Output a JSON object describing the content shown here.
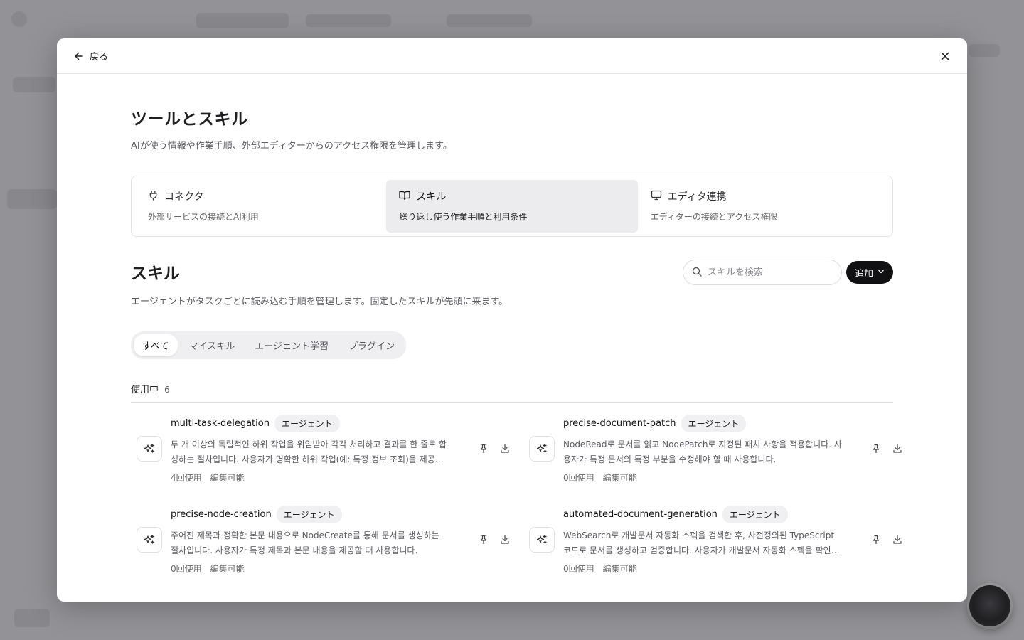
{
  "header": {
    "back_label": "戻る"
  },
  "page": {
    "title": "ツールとスキル",
    "subtitle": "AIが使う情報や作業手順、外部エディターからのアクセス権限を管理します。"
  },
  "category_tabs": [
    {
      "label": "コネクタ",
      "desc": "外部サービスの接続とAI利用",
      "icon": "plug-icon"
    },
    {
      "label": "スキル",
      "desc": "繰り返し使う作業手順と利用条件",
      "icon": "book-icon"
    },
    {
      "label": "エディタ連携",
      "desc": "エディターの接続とアクセス権限",
      "icon": "monitor-icon"
    }
  ],
  "section": {
    "title": "スキル",
    "desc": "エージェントがタスクごとに読み込む手順を管理します。固定したスキルが先頭に来ます。",
    "search_placeholder": "スキルを検索",
    "add_label": "追加"
  },
  "filter_tabs": [
    "すべて",
    "マイスキル",
    "エージェント学習",
    "プラグイン"
  ],
  "group": {
    "label": "使用中",
    "count": "6"
  },
  "skills": [
    {
      "name": "multi-task-delegation",
      "badge": "エージェント",
      "desc": "두 개 이상의 독립적인 하위 작업을 위임받아 각각 처리하고 결과를 한 줄로 합성하는 절차입니다. 사용자가 명확한 하위 작업(예: 특정 정보 조회)을 제공…",
      "usage": "4回使用",
      "editable": "編集可能"
    },
    {
      "name": "precise-document-patch",
      "badge": "エージェント",
      "desc": "NodeRead로 문서를 읽고 NodePatch로 지정된 패치 사항을 적용합니다. 사용자가 특정 문서의 특정 부분을 수정해야 할 때 사용합니다.",
      "usage": "0回使用",
      "editable": "編集可能"
    },
    {
      "name": "precise-node-creation",
      "badge": "エージェント",
      "desc": "주어진 제목과 정확한 본문 내용으로 NodeCreate를 통해 문서를 생성하는 절차입니다. 사용자가 특정 제목과 본문 내용을 제공할 때 사용합니다.",
      "usage": "0回使用",
      "editable": "編集可能"
    },
    {
      "name": "automated-document-generation",
      "badge": "エージェント",
      "desc": "WebSearch로 개발문서 자동화 스펙을 검색한 후, 사전정의된 TypeScript 코드로 문서를 생성하고 검증합니다. 사용자가 개발문서 자동화 스펙을 확인…",
      "usage": "0回使用",
      "editable": "編集可能"
    }
  ],
  "colors": {
    "accent": "#111114",
    "active_tab_bg": "#ececef",
    "badge_bg": "#f0f0f2"
  }
}
